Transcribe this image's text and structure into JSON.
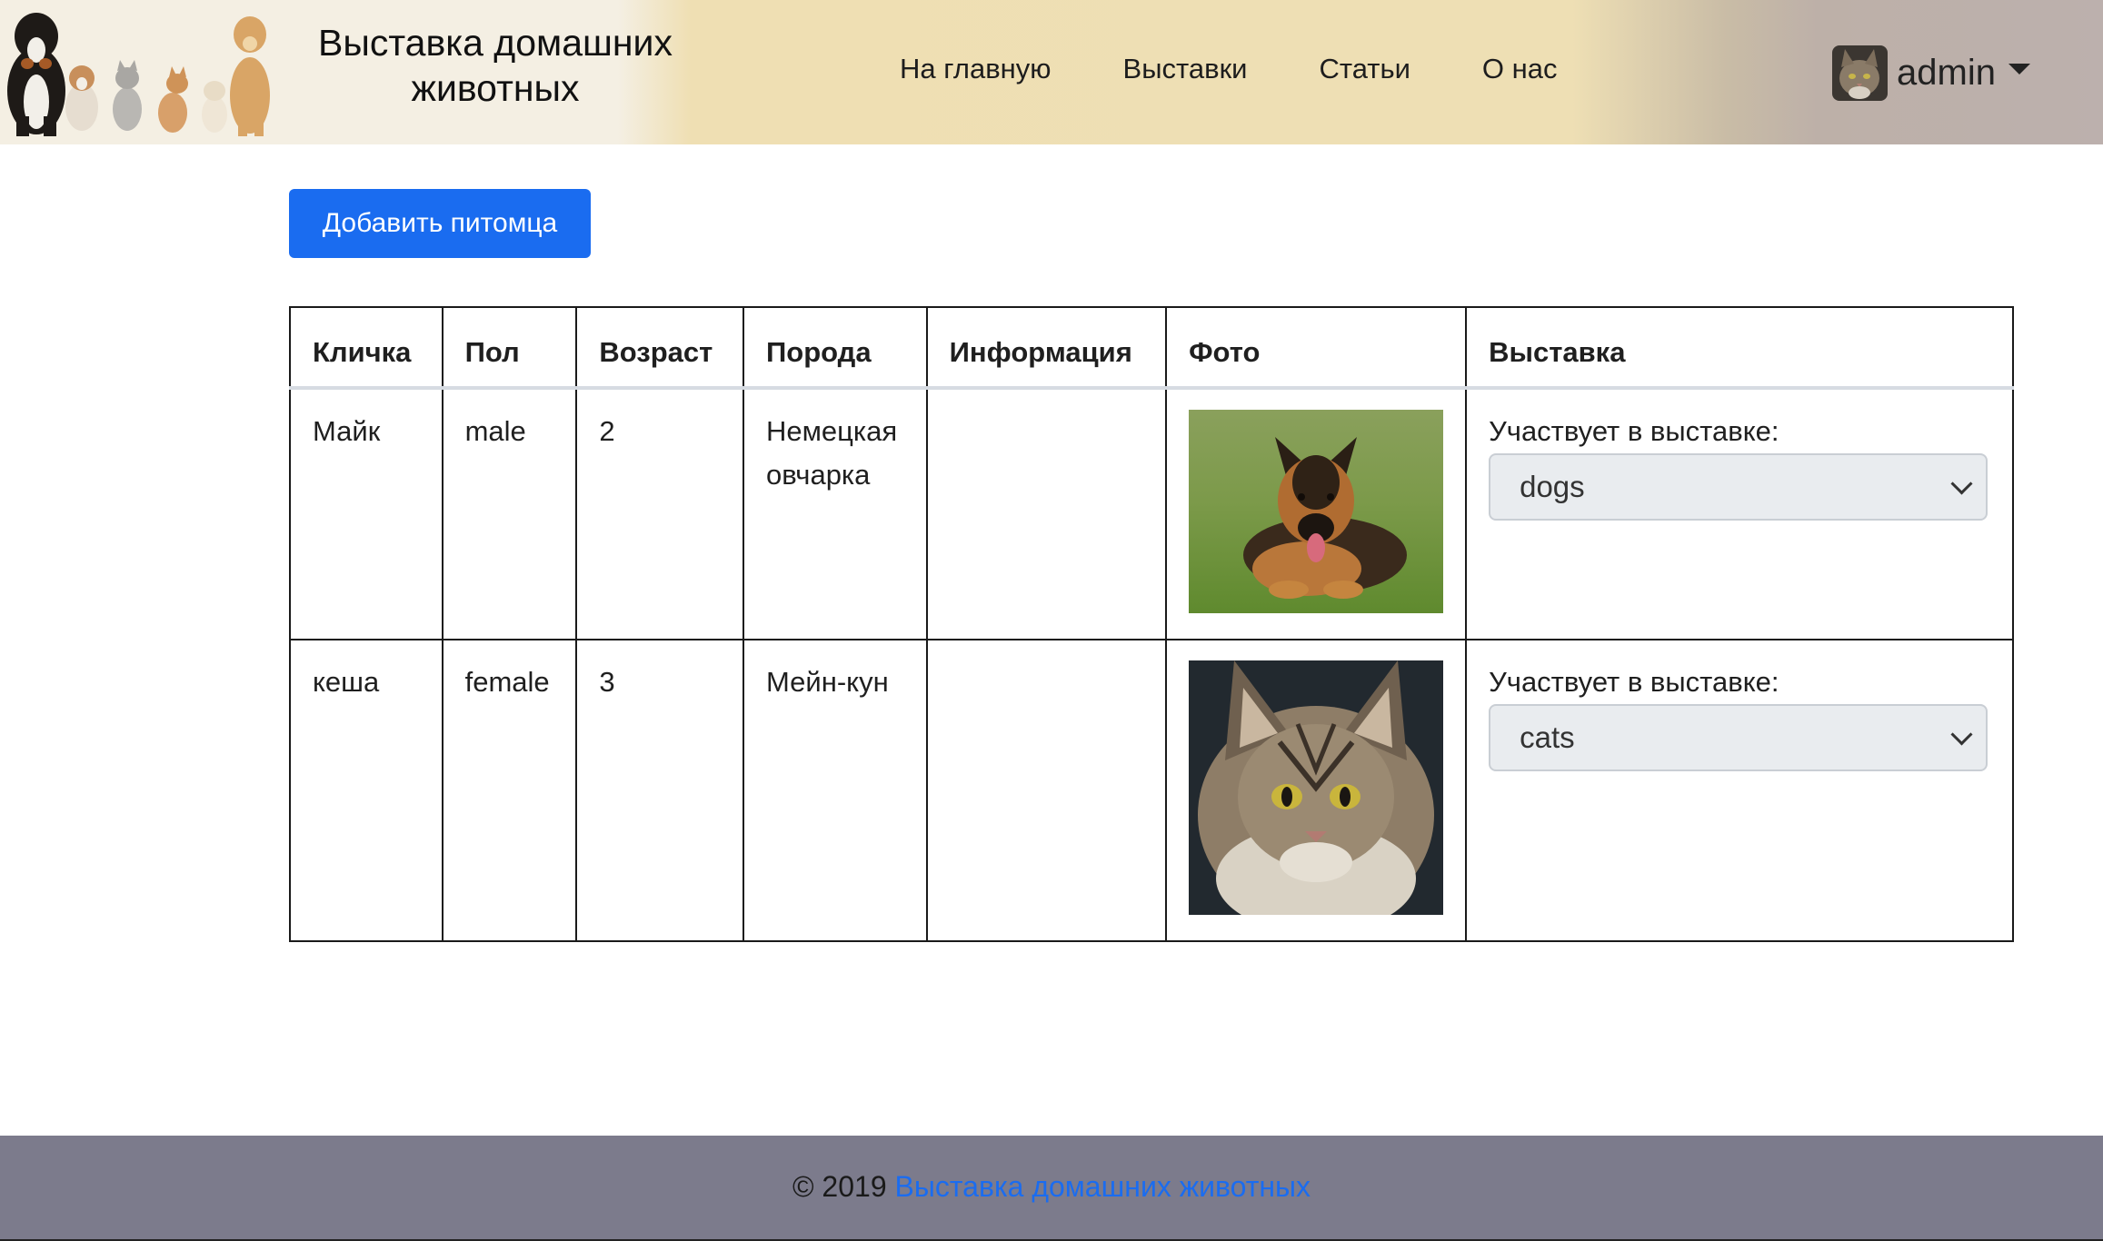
{
  "header": {
    "brand": "Выставка домашних животных",
    "nav": [
      "На главную",
      "Выставки",
      "Статьи",
      "О нас"
    ],
    "user": {
      "name": "admin"
    }
  },
  "main": {
    "add_button_label": "Добавить питомца",
    "table": {
      "headers": [
        "Кличка",
        "Пол",
        "Возраст",
        "Порода",
        "Информация",
        "Фото",
        "Выставка"
      ],
      "rows": [
        {
          "name": "Майк",
          "sex": "male",
          "age": "2",
          "breed": "Немецкая овчарка",
          "info": "",
          "exhibition_label": "Участвует в выставке:",
          "exhibition_value": "dogs"
        },
        {
          "name": "кеша",
          "sex": "female",
          "age": "3",
          "breed": "Мейн-кун",
          "info": "",
          "exhibition_label": "Участвует в выставке:",
          "exhibition_value": "cats"
        }
      ]
    }
  },
  "footer": {
    "copyright": "© 2019",
    "link": "Выставка домашних животных"
  },
  "colors": {
    "primary": "#1a6cf0",
    "footer_bg": "#7c7b8c",
    "header_gold": "#eedfb4"
  }
}
